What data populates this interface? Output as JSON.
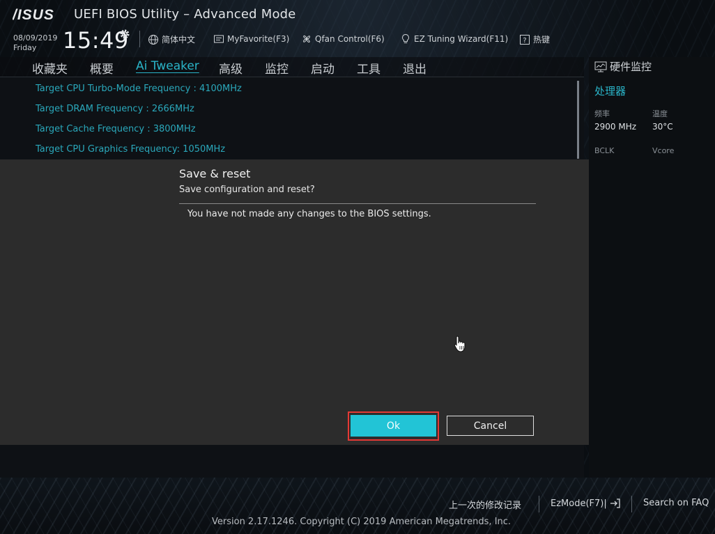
{
  "header": {
    "brand": "ASUS",
    "title": "UEFI BIOS Utility – Advanced Mode",
    "date": "08/09/2019",
    "day": "Friday",
    "time": "15:49",
    "toolbar": [
      {
        "label": "简体中文",
        "icon": "globe-icon"
      },
      {
        "label": "MyFavorite(F3)",
        "icon": "favorite-icon"
      },
      {
        "label": "Qfan Control(F6)",
        "icon": "fan-icon"
      },
      {
        "label": "EZ Tuning Wizard(F11)",
        "icon": "lightbulb-icon"
      },
      {
        "label": "热键",
        "icon": "help-icon"
      }
    ]
  },
  "tabs": [
    "收藏夹",
    "概要",
    "Ai Tweaker",
    "高级",
    "监控",
    "启动",
    "工具",
    "退出"
  ],
  "active_tab": "Ai Tweaker",
  "main": {
    "items": [
      "Target CPU Turbo-Mode Frequency : 4100MHz",
      "Target DRAM Frequency : 2666MHz",
      "Target Cache Frequency : 3800MHz",
      "Target CPU Graphics Frequency: 1050MHz"
    ]
  },
  "hw_monitor": {
    "title": "硬件监控",
    "section": "处理器",
    "freq_label": "频率",
    "temp_label": "温度",
    "freq_value": "2900 MHz",
    "temp_value": "30°C",
    "bclk_label": "BCLK",
    "vcore_label": "Vcore"
  },
  "dialog": {
    "title": "Save & reset",
    "subtitle": "Save configuration and reset?",
    "message": "You have not made any changes to the BIOS settings.",
    "ok_label": "Ok",
    "cancel_label": "Cancel"
  },
  "footer": {
    "last_modified": "上一次的修改记录",
    "ezmode": "EzMode(F7)|",
    "faq": "Search on FAQ",
    "copyright": "Version 2.17.1246. Copyright (C) 2019 American Megatrends, Inc."
  },
  "colors": {
    "accent": "#2ab4c8",
    "ok_button": "#22c4d6",
    "highlight_outline": "#e53935",
    "dialog_bg": "#2c2c2c"
  }
}
